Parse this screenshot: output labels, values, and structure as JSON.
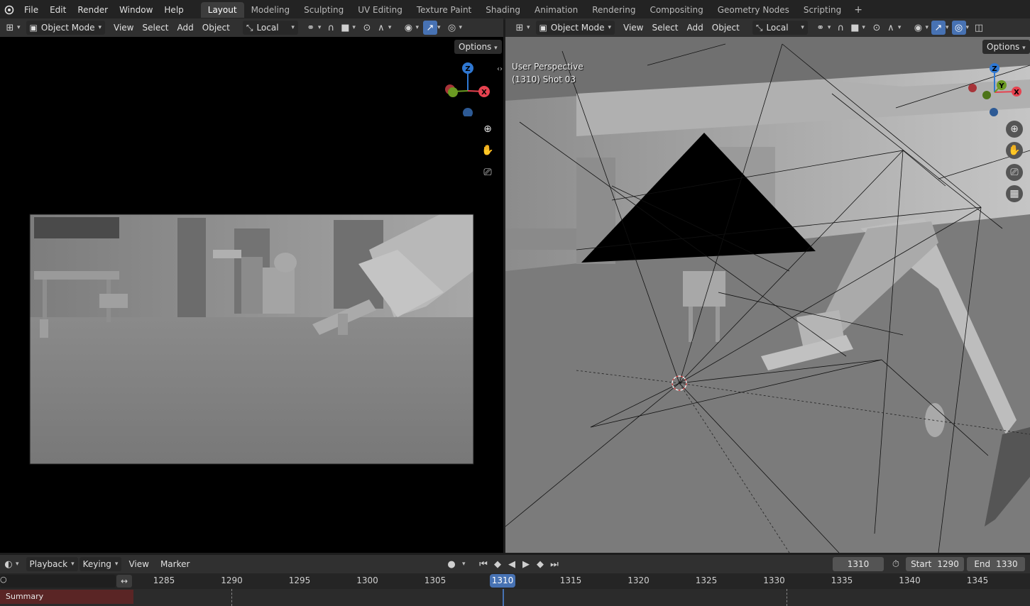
{
  "menu": [
    "File",
    "Edit",
    "Render",
    "Window",
    "Help"
  ],
  "workspaces": [
    "Layout",
    "Modeling",
    "Sculpting",
    "UV Editing",
    "Texture Paint",
    "Shading",
    "Animation",
    "Rendering",
    "Compositing",
    "Geometry Nodes",
    "Scripting"
  ],
  "active_workspace": "Layout",
  "workspace_add": "+",
  "viewport_header": {
    "mode": "Object Mode",
    "view": "View",
    "select": "Select",
    "add": "Add",
    "object": "Object",
    "orientation": "Local",
    "options": "Options"
  },
  "right_viewport": {
    "perspective": "User Perspective",
    "frame_info": "(1310) Shot 03"
  },
  "gizmo": {
    "z": "Z",
    "x": "X",
    "y": "Y"
  },
  "colors": {
    "accent": "#4772b3",
    "gizmo_x": "#e6424f",
    "gizmo_y": "#6b9a22",
    "gizmo_z": "#2f78d3",
    "summary_bg": "#5a2525",
    "current_frame": "#4772b3"
  },
  "timeline": {
    "playback": "Playback",
    "keying": "Keying",
    "view": "View",
    "marker": "Marker",
    "current_frame": "1310",
    "start_label": "Start",
    "start": "1290",
    "end_label": "End",
    "end": "1330",
    "ticks": [
      "1285",
      "1290",
      "1295",
      "1300",
      "1305",
      "1310",
      "1315",
      "1320",
      "1325",
      "1330",
      "1335",
      "1340",
      "1345"
    ],
    "summary": "Summary"
  }
}
